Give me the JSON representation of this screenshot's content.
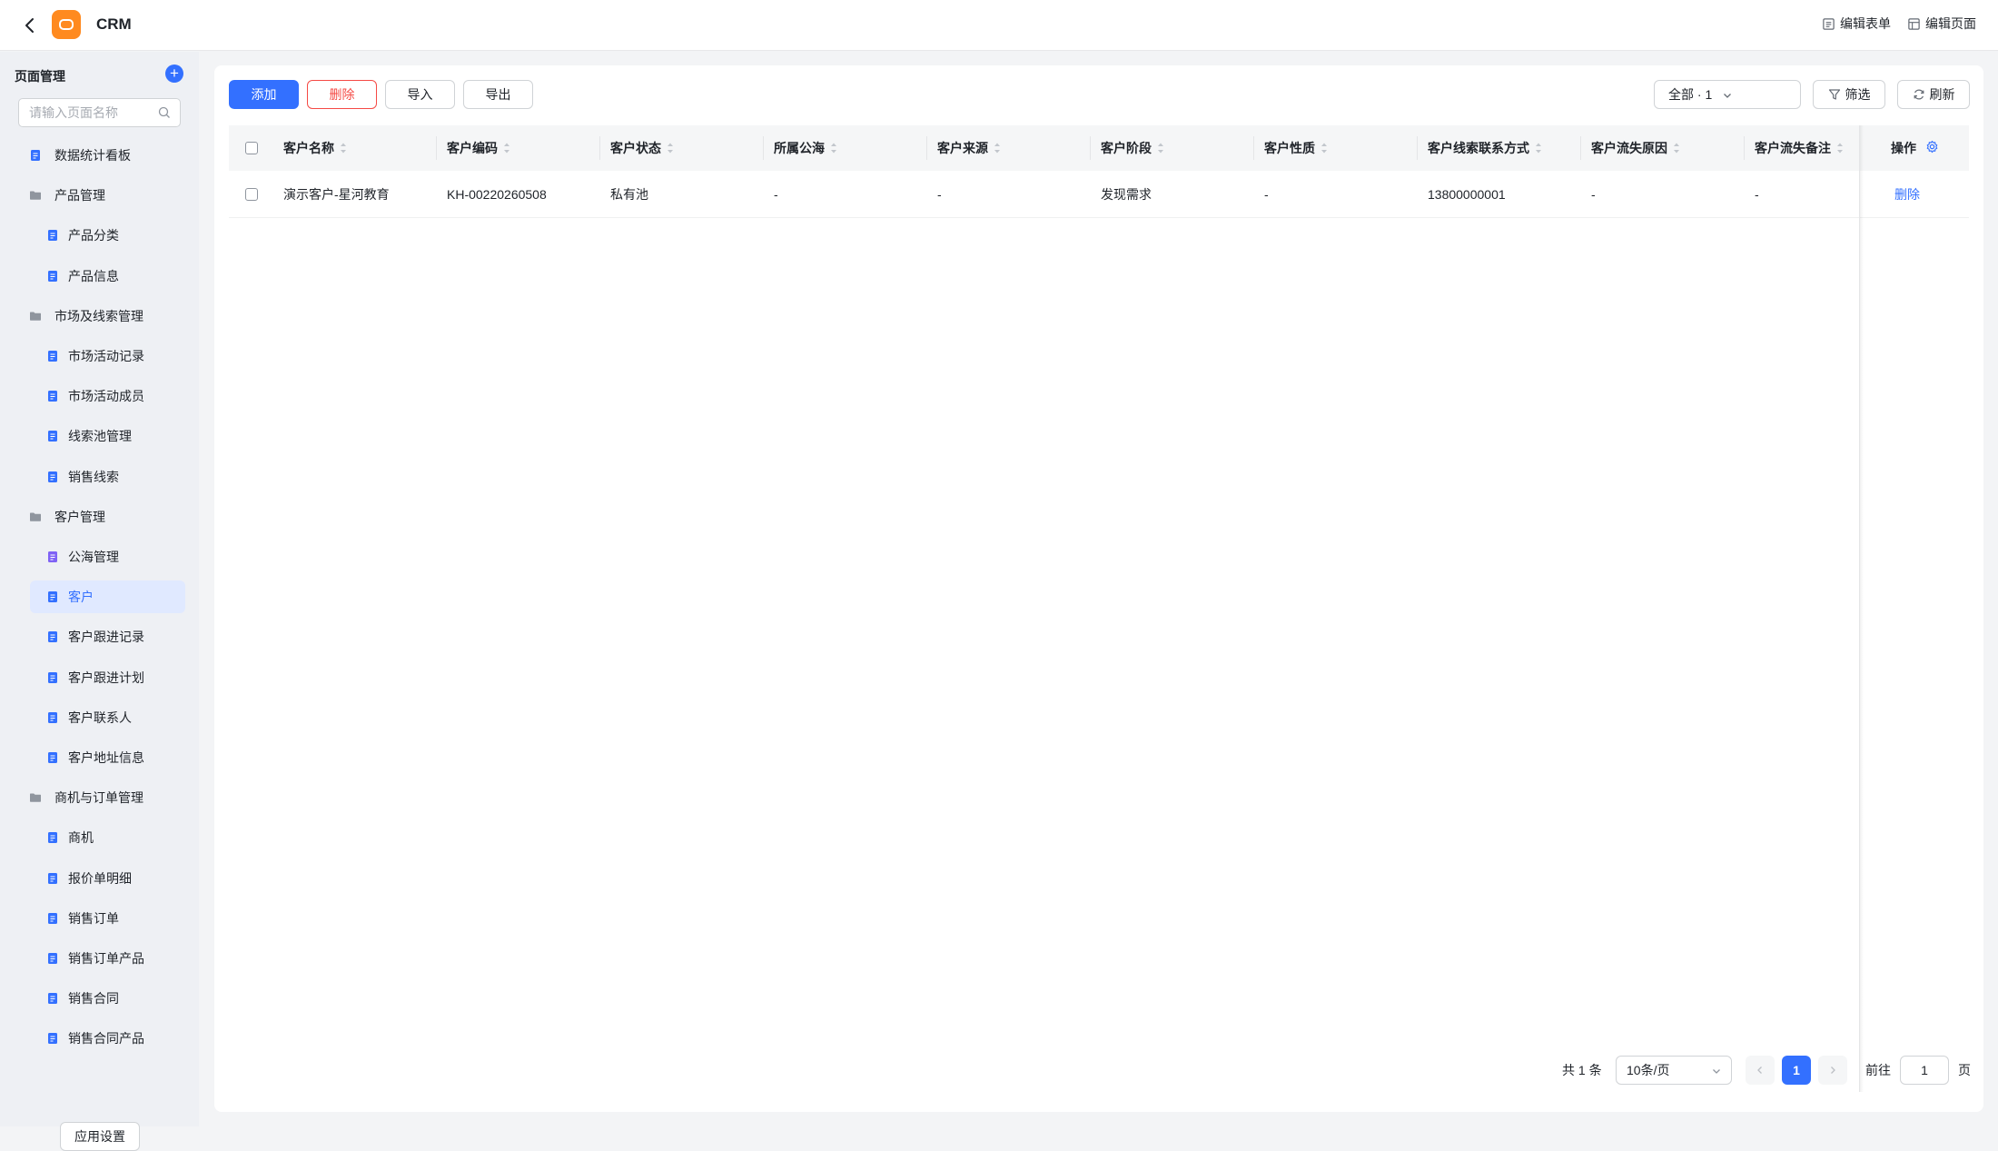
{
  "topbar": {
    "app_title": "CRM",
    "logo_text": "CRM",
    "actions": [
      {
        "label": "编辑表单",
        "icon": "form-icon"
      },
      {
        "label": "编辑页面",
        "icon": "layout-icon"
      }
    ]
  },
  "sidebar": {
    "title": "页面管理",
    "search_placeholder": "请输入页面名称",
    "items": [
      {
        "label": "数据统计看板",
        "type": "page",
        "level": 1
      },
      {
        "label": "产品管理",
        "type": "folder",
        "level": 1
      },
      {
        "label": "产品分类",
        "type": "page",
        "level": 2
      },
      {
        "label": "产品信息",
        "type": "page",
        "level": 2
      },
      {
        "label": "市场及线索管理",
        "type": "folder",
        "level": 1
      },
      {
        "label": "市场活动记录",
        "type": "page",
        "level": 2
      },
      {
        "label": "市场活动成员",
        "type": "page",
        "level": 2
      },
      {
        "label": "线索池管理",
        "type": "page",
        "level": 2
      },
      {
        "label": "销售线索",
        "type": "page",
        "level": 2
      },
      {
        "label": "客户管理",
        "type": "folder",
        "level": 1
      },
      {
        "label": "公海管理",
        "type": "page-alt",
        "level": 2
      },
      {
        "label": "客户",
        "type": "page",
        "level": 2,
        "active": true
      },
      {
        "label": "客户跟进记录",
        "type": "page",
        "level": 2
      },
      {
        "label": "客户跟进计划",
        "type": "page",
        "level": 2
      },
      {
        "label": "客户联系人",
        "type": "page",
        "level": 2
      },
      {
        "label": "客户地址信息",
        "type": "page",
        "level": 2
      },
      {
        "label": "商机与订单管理",
        "type": "folder",
        "level": 1
      },
      {
        "label": "商机",
        "type": "page",
        "level": 2
      },
      {
        "label": "报价单明细",
        "type": "page",
        "level": 2
      },
      {
        "label": "销售订单",
        "type": "page",
        "level": 2
      },
      {
        "label": "销售订单产品",
        "type": "page",
        "level": 2
      },
      {
        "label": "销售合同",
        "type": "page",
        "level": 2
      },
      {
        "label": "销售合同产品",
        "type": "page",
        "level": 2
      }
    ],
    "settings_label": "应用设置"
  },
  "toolbar": {
    "add": "添加",
    "delete": "删除",
    "import": "导入",
    "export": "导出",
    "view": "全部 · 1",
    "filter": "筛选",
    "refresh": "刷新"
  },
  "table": {
    "columns": [
      "客户名称",
      "客户编码",
      "客户状态",
      "所属公海",
      "客户来源",
      "客户阶段",
      "客户性质",
      "客户线索联系方式",
      "客户流失原因",
      "客户流失备注"
    ],
    "action_column": "操作",
    "rows": [
      {
        "cells": [
          "演示客户-星河教育",
          "KH-00220260508",
          "私有池",
          "-",
          "-",
          "发现需求",
          "-",
          "13800000001",
          "-",
          "-"
        ],
        "action": "删除"
      }
    ]
  },
  "pagination": {
    "total": "共 1 条",
    "page_size": "10条/页",
    "current": "1",
    "goto_label": "前往",
    "goto_value": "1",
    "page_unit": "页"
  },
  "colors": {
    "primary": "#3370ff",
    "danger": "#f54a45",
    "logo": "#ff8a1f"
  }
}
